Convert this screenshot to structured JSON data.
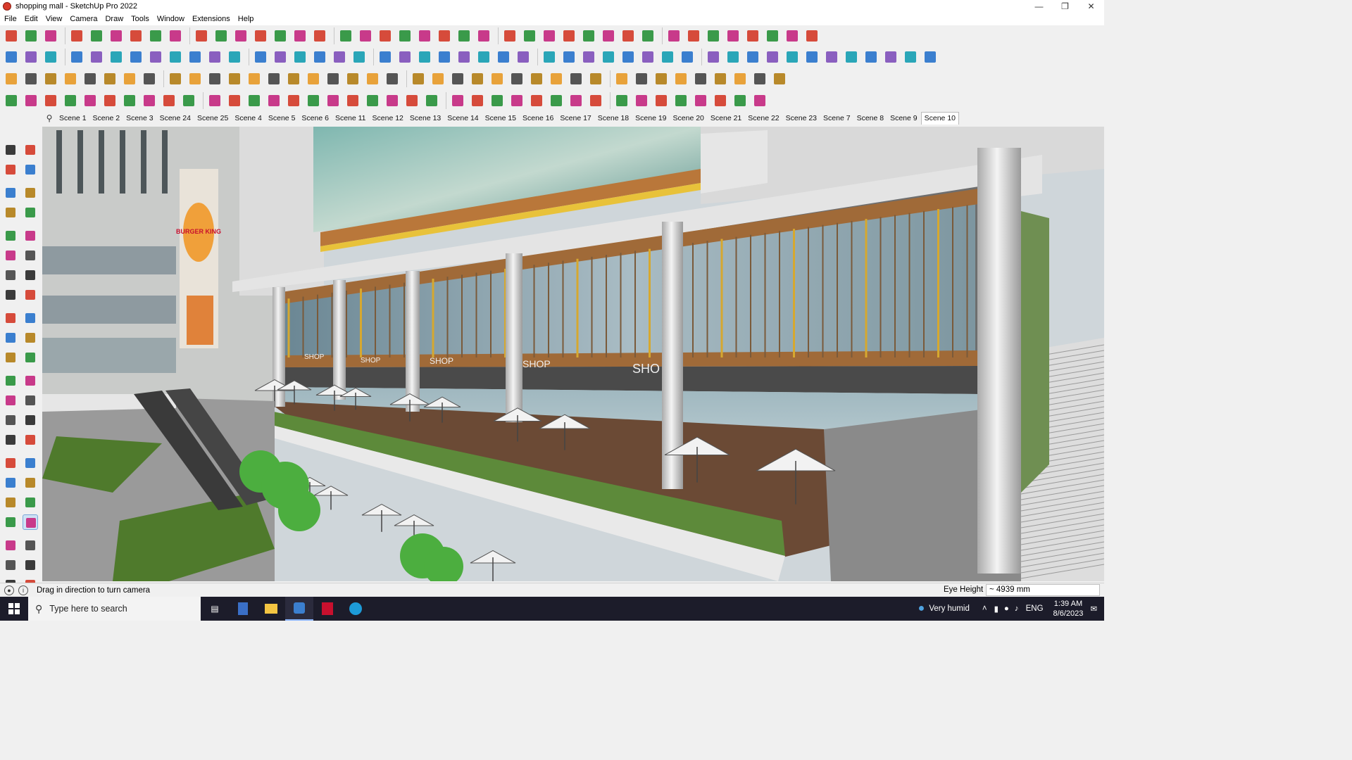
{
  "window": {
    "title": "shopping mall - SketchUp Pro 2022",
    "controls": [
      "minimize-icon",
      "restore-icon",
      "close-icon"
    ]
  },
  "menu": [
    "File",
    "Edit",
    "View",
    "Camera",
    "Draw",
    "Tools",
    "Window",
    "Extensions",
    "Help"
  ],
  "scenes": {
    "tabs": [
      "Scene 1",
      "Scene 2",
      "Scene 3",
      "Scene 24",
      "Scene 25",
      "Scene 4",
      "Scene 5",
      "Scene 6",
      "Scene 11",
      "Scene 12",
      "Scene 13",
      "Scene 14",
      "Scene 15",
      "Scene 16",
      "Scene 17",
      "Scene 18",
      "Scene 19",
      "Scene 20",
      "Scene 21",
      "Scene 22",
      "Scene 23",
      "Scene 7",
      "Scene 8",
      "Scene 9",
      "Scene 10"
    ],
    "active": "Scene 10"
  },
  "viewport": {
    "signs": [
      "SHOP",
      "SHOP",
      "SHOP",
      "SHOP",
      "SHO"
    ],
    "billboard": "BURGER KING"
  },
  "status": {
    "hint": "Drag in direction to turn camera",
    "measure_label": "Eye Height",
    "measure_value": "~ 4939 mm"
  },
  "taskbar": {
    "search_placeholder": "Type here to search",
    "weather": "Very humid",
    "language": "ENG",
    "time": "1:39 AM",
    "date": "8/6/2023"
  },
  "colors": {
    "accent": "#0078d4",
    "taskbar": "#1c1c2a",
    "toolbar_bg": "#f0f0f0"
  }
}
